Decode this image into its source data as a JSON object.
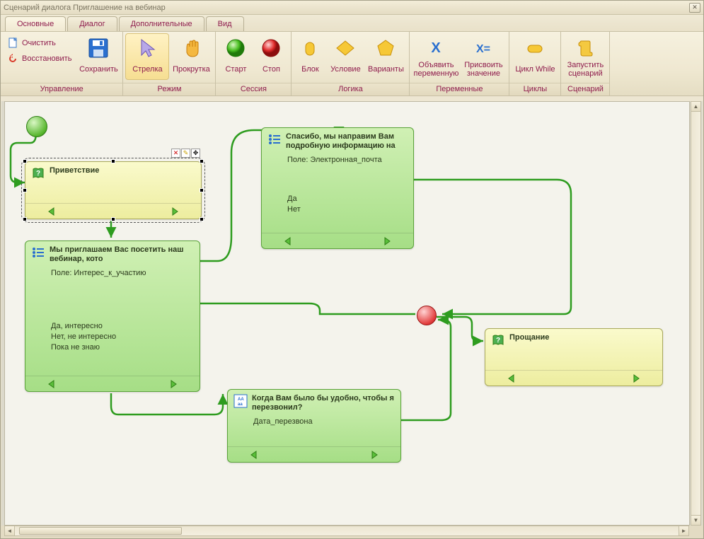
{
  "window": {
    "title": "Сценарий диалога Приглашение на вебинар"
  },
  "tabs": {
    "main": "Основные",
    "dialog": "Диалог",
    "extra": "Дополнительные",
    "view": "Вид"
  },
  "ribbon": {
    "manage": {
      "label": "Управление",
      "clear": "Очистить",
      "restore": "Восстановить",
      "save": "Сохранить"
    },
    "mode": {
      "label": "Режим",
      "arrow": "Стрелка",
      "scroll": "Прокрутка"
    },
    "session": {
      "label": "Сессия",
      "start": "Старт",
      "stop": "Стоп"
    },
    "logic": {
      "label": "Логика",
      "block": "Блок",
      "cond": "Условие",
      "variants": "Варианты"
    },
    "vars": {
      "label": "Переменные",
      "declare": "Объявить\nпеременную",
      "assign": "Присвоить\nзначение"
    },
    "loops": {
      "label": "Циклы",
      "while": "Цикл While"
    },
    "scenario": {
      "label": "Сценарий",
      "run": "Запустить\nсценарий"
    }
  },
  "nodes": {
    "greeting": {
      "title": "Приветствие"
    },
    "invite": {
      "title": "Мы приглашаем Вас посетить наш вебинар, кото",
      "field": "Поле: Интерес_к_участию",
      "opt1": "Да, интересно",
      "opt2": "Нет, не интересно",
      "opt3": "Пока не знаю"
    },
    "thanks": {
      "title": "Спасибо, мы направим Вам подробную информацию на",
      "field": "Поле: Электронная_почта",
      "opt1": "Да",
      "opt2": "Нет"
    },
    "callback": {
      "title": "Когда Вам было бы удобно, чтобы я перезвонил?",
      "field": "Дата_перезвона"
    },
    "farewell": {
      "title": "Прощание"
    }
  }
}
